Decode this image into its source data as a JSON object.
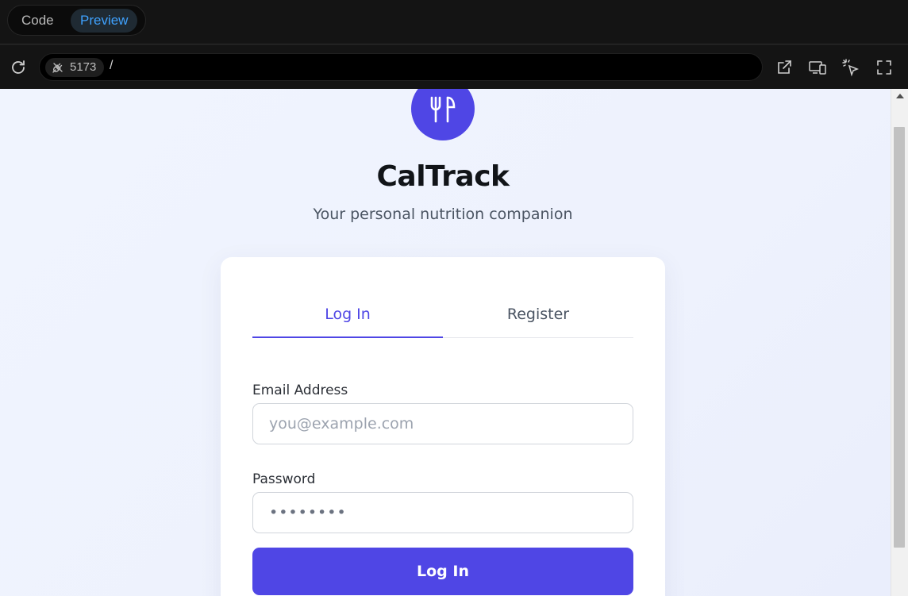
{
  "toolbar": {
    "mode_code": "Code",
    "mode_preview": "Preview",
    "active_mode": "Preview"
  },
  "address": {
    "port": "5173",
    "path": "/"
  },
  "icons": {
    "reload": "reload-icon",
    "plug": "plug-icon",
    "open_external": "open-external-icon",
    "responsive": "responsive-devices-icon",
    "inspect": "inspect-pointer-icon",
    "fullscreen": "fullscreen-icon",
    "logo": "fork-knife-icon"
  },
  "app": {
    "title": "CalTrack",
    "subtitle": "Your personal nutrition companion"
  },
  "auth": {
    "tabs": [
      {
        "label": "Log In",
        "active": true
      },
      {
        "label": "Register",
        "active": false
      }
    ],
    "email_label": "Email Address",
    "email_placeholder": "you@example.com",
    "password_label": "Password",
    "password_value": "••••••••",
    "submit_label": "Log In"
  },
  "colors": {
    "accent": "#4f46e5",
    "preview_active": "#3fa2ff",
    "page_bg": "#eef2fd"
  }
}
